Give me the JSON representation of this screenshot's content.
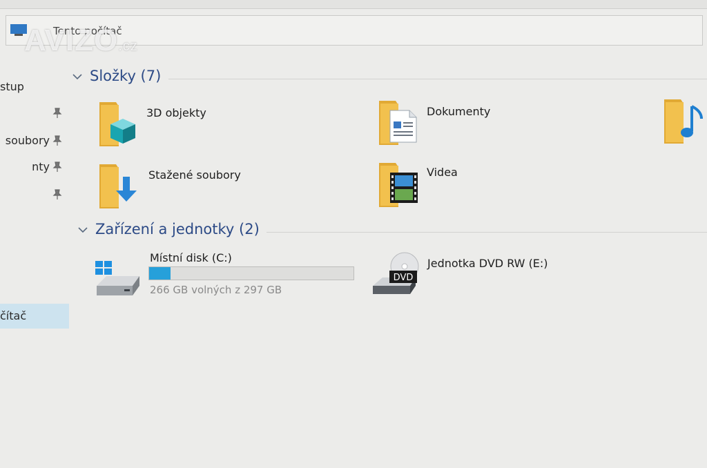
{
  "address_bar": {
    "path": "Tento počítač"
  },
  "watermark": {
    "name": "AVIZO",
    "suffix": ".cz"
  },
  "nav": {
    "items": [
      {
        "label": "stup",
        "pinned": false
      },
      {
        "label": "",
        "pinned": true
      },
      {
        "label": "soubory",
        "pinned": true
      },
      {
        "label": "nty",
        "pinned": true
      },
      {
        "label": "",
        "pinned": true
      },
      {
        "label": "čítač",
        "selected": true
      }
    ]
  },
  "folders": {
    "title": "Složky (7)",
    "items": [
      {
        "label": "3D objekty",
        "icon": "3d-objects-folder-icon"
      },
      {
        "label": "Dokumenty",
        "icon": "documents-folder-icon"
      },
      {
        "label": "",
        "icon": "music-folder-icon"
      },
      {
        "label": "Stažené soubory",
        "icon": "downloads-folder-icon"
      },
      {
        "label": "Videa",
        "icon": "videos-folder-icon"
      }
    ]
  },
  "devices": {
    "title": "Zařízení a jednotky (2)",
    "items": [
      {
        "label": "Místní disk (C:)",
        "icon": "local-disk-icon",
        "free_text": "266 GB volných z 297 GB",
        "used_fraction": 0.104
      },
      {
        "label": "Jednotka DVD RW (E:)",
        "icon": "dvd-drive-icon",
        "badge": "DVD"
      }
    ]
  },
  "colors": {
    "accent": "#26a0da",
    "section_title": "#2c4a86",
    "selection": "#cde3ef",
    "folder": "#f2c14e"
  }
}
